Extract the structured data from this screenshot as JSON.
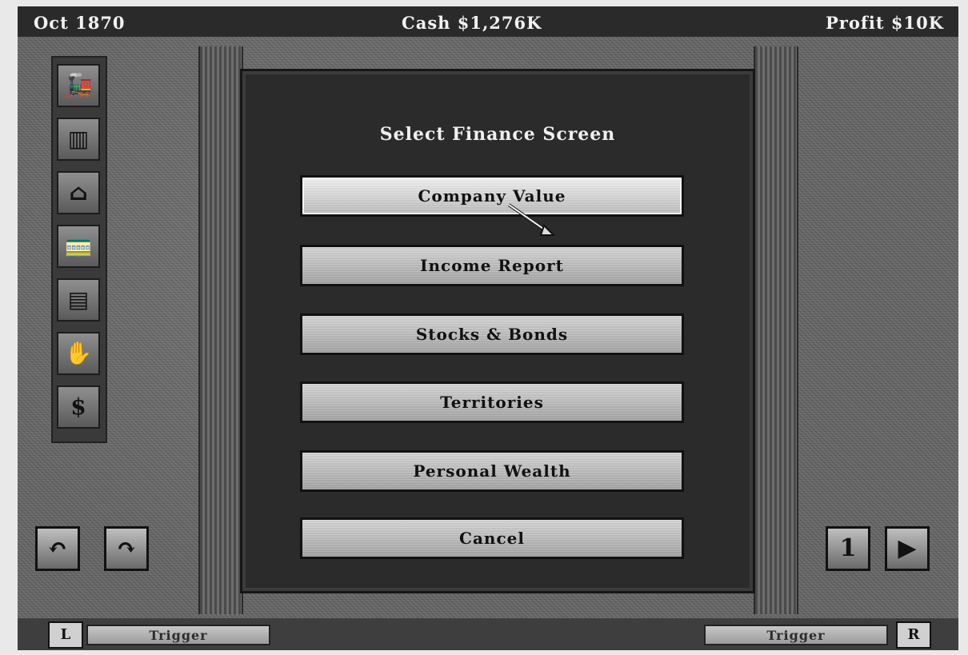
{
  "status": {
    "date": "Oct 1870",
    "cash": "Cash $1,276K",
    "profit": "Profit $10K"
  },
  "dialog": {
    "title": "Select Finance Screen",
    "buttons": [
      {
        "label": "Company Value",
        "selected": true
      },
      {
        "label": "Income Report",
        "selected": false
      },
      {
        "label": "Stocks & Bonds",
        "selected": false
      },
      {
        "label": "Territories",
        "selected": false
      },
      {
        "label": "Personal Wealth",
        "selected": false
      },
      {
        "label": "Cancel",
        "selected": false
      }
    ]
  },
  "left_tools": [
    {
      "icon": "locomotive-icon",
      "glyph": "🚂"
    },
    {
      "icon": "track-icon",
      "glyph": "▥"
    },
    {
      "icon": "station-icon",
      "glyph": "⌂"
    },
    {
      "icon": "train-icon",
      "glyph": "🚃"
    },
    {
      "icon": "building-icon",
      "glyph": "▤"
    },
    {
      "icon": "hand-icon",
      "glyph": "✋"
    },
    {
      "icon": "finance-icon",
      "glyph": "$"
    }
  ],
  "bottom_controls": {
    "left": [
      {
        "icon": "undo-icon",
        "glyph": "↶"
      },
      {
        "icon": "redo-icon",
        "glyph": "↷"
      }
    ],
    "right": [
      {
        "icon": "page-one-icon",
        "glyph": "1"
      },
      {
        "icon": "play-icon",
        "glyph": "▶"
      }
    ]
  },
  "bottom_bar": {
    "left_tag": "L",
    "left_trigger": "Trigger",
    "right_trigger": "Trigger",
    "right_tag": "R"
  }
}
